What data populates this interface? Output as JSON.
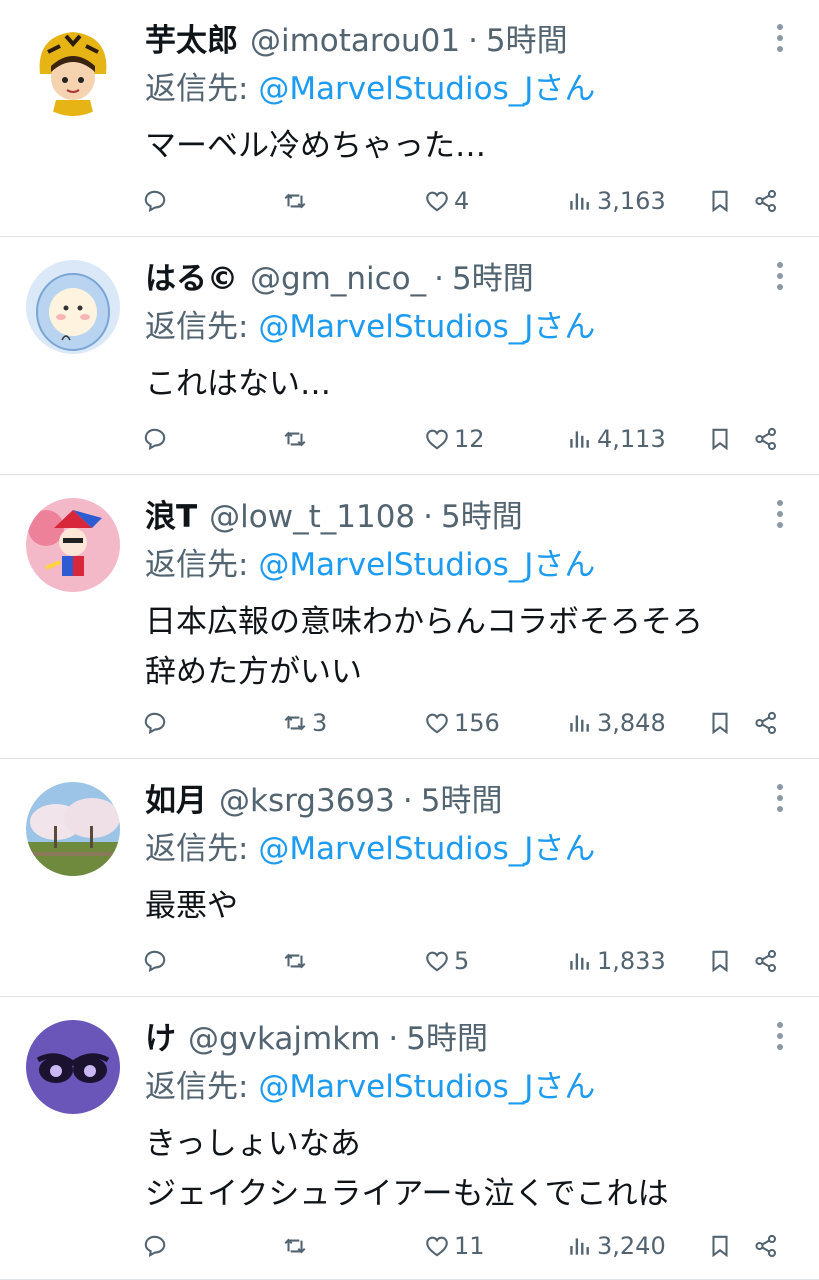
{
  "colors": {
    "accent": "#1d9bf0",
    "secondary_text": "#536471",
    "divider": "#dfe3e6"
  },
  "tweets": [
    {
      "name": "芋太郎",
      "handle": "@imotarou01",
      "separator": "·",
      "time": "5時間",
      "reply_prefix": "返信先: ",
      "reply_to": "@MarvelStudios_Jさん",
      "text": "マーベル冷めちゃった…",
      "avatar_icon": "tiger-costume-avatar",
      "replies": "",
      "reposts": "",
      "likes": "4",
      "views": "3,163"
    },
    {
      "name": "はる©",
      "handle": "@gm_nico_",
      "separator": "·",
      "time": "5時間",
      "reply_prefix": "返信先: ",
      "reply_to": "@MarvelStudios_Jさん",
      "text": "これはない…",
      "avatar_icon": "hooded-character-avatar",
      "replies": "",
      "reposts": "",
      "likes": "12",
      "views": "4,113"
    },
    {
      "name": "浪T",
      "handle": "@low_t_1108",
      "separator": "·",
      "time": "5時間",
      "reply_prefix": "返信先: ",
      "reply_to": "@MarvelStudios_Jさん",
      "text": "日本広報の意味わからんコラボそろそろ\n辞めた方がいい",
      "avatar_icon": "jester-character-avatar",
      "replies": "",
      "reposts": "3",
      "likes": "156",
      "views": "3,848"
    },
    {
      "name": "如月",
      "handle": "@ksrg3693",
      "separator": "·",
      "time": "5時間",
      "reply_prefix": "返信先: ",
      "reply_to": "@MarvelStudios_Jさん",
      "text": "最悪や",
      "avatar_icon": "cherry-blossom-photo-avatar",
      "replies": "",
      "reposts": "",
      "likes": "5",
      "views": "1,833"
    },
    {
      "name": "け",
      "handle": "@gvkajmkm",
      "separator": "·",
      "time": "5時間",
      "reply_prefix": "返信先: ",
      "reply_to": "@MarvelStudios_Jさん",
      "text": "きっしょいなあ\nジェイクシュライアーも泣くでこれは",
      "avatar_icon": "purple-eyes-avatar",
      "replies": "",
      "reposts": "",
      "likes": "11",
      "views": "3,240"
    }
  ]
}
